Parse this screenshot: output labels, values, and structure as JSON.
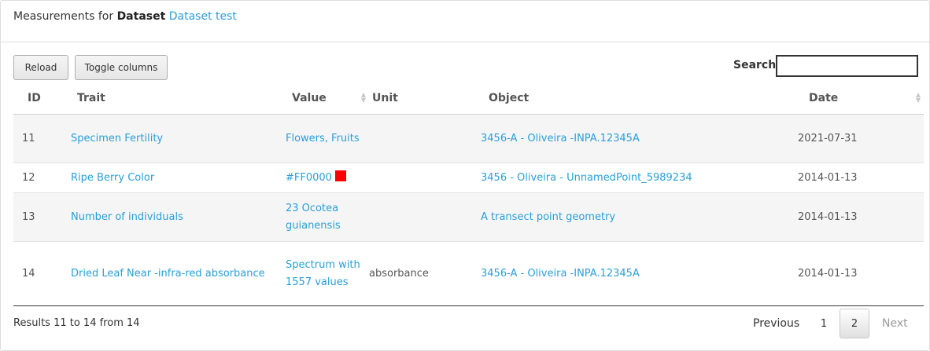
{
  "header": {
    "prefix": "Measurements for",
    "entity_type": "Dataset",
    "entity_name": "Dataset test"
  },
  "toolbar": {
    "reload_label": "Reload",
    "toggle_columns_label": "Toggle columns",
    "search_label": "Search",
    "search_value": ""
  },
  "table": {
    "columns": [
      "ID",
      "Trait",
      "Value",
      "Unit",
      "Object",
      "Date"
    ],
    "rows": [
      {
        "id": "11",
        "trait": "Specimen Fertility",
        "value": "Flowers, Fruits",
        "unit": "",
        "object": "3456-A - Oliveira -INPA.12345A",
        "date": "2021-07-31"
      },
      {
        "id": "12",
        "trait": "Ripe Berry Color",
        "value": "#FF0000",
        "value_color": "#FF0000",
        "unit": "",
        "object": "3456 - Oliveira - UnnamedPoint_5989234",
        "date": "2014-01-13"
      },
      {
        "id": "13",
        "trait": "Number of individuals",
        "value": "23 Ocotea guianensis",
        "unit": "",
        "object": "A transect point geometry",
        "date": "2014-01-13"
      },
      {
        "id": "14",
        "trait": "Dried Leaf Near -infra-red absorbance",
        "value": "Spectrum with 1557 values",
        "unit": "absorbance",
        "object": "3456-A - Oliveira -INPA.12345A",
        "date": "2014-01-13"
      }
    ]
  },
  "footer": {
    "results_info": "Results 11 to 14 from 14",
    "previous_label": "Previous",
    "pages": [
      "1",
      "2"
    ],
    "current_page": "2",
    "next_label": "Next"
  },
  "colors": {
    "link": "#2a9fd6",
    "swatch_red": "#FF0000"
  }
}
